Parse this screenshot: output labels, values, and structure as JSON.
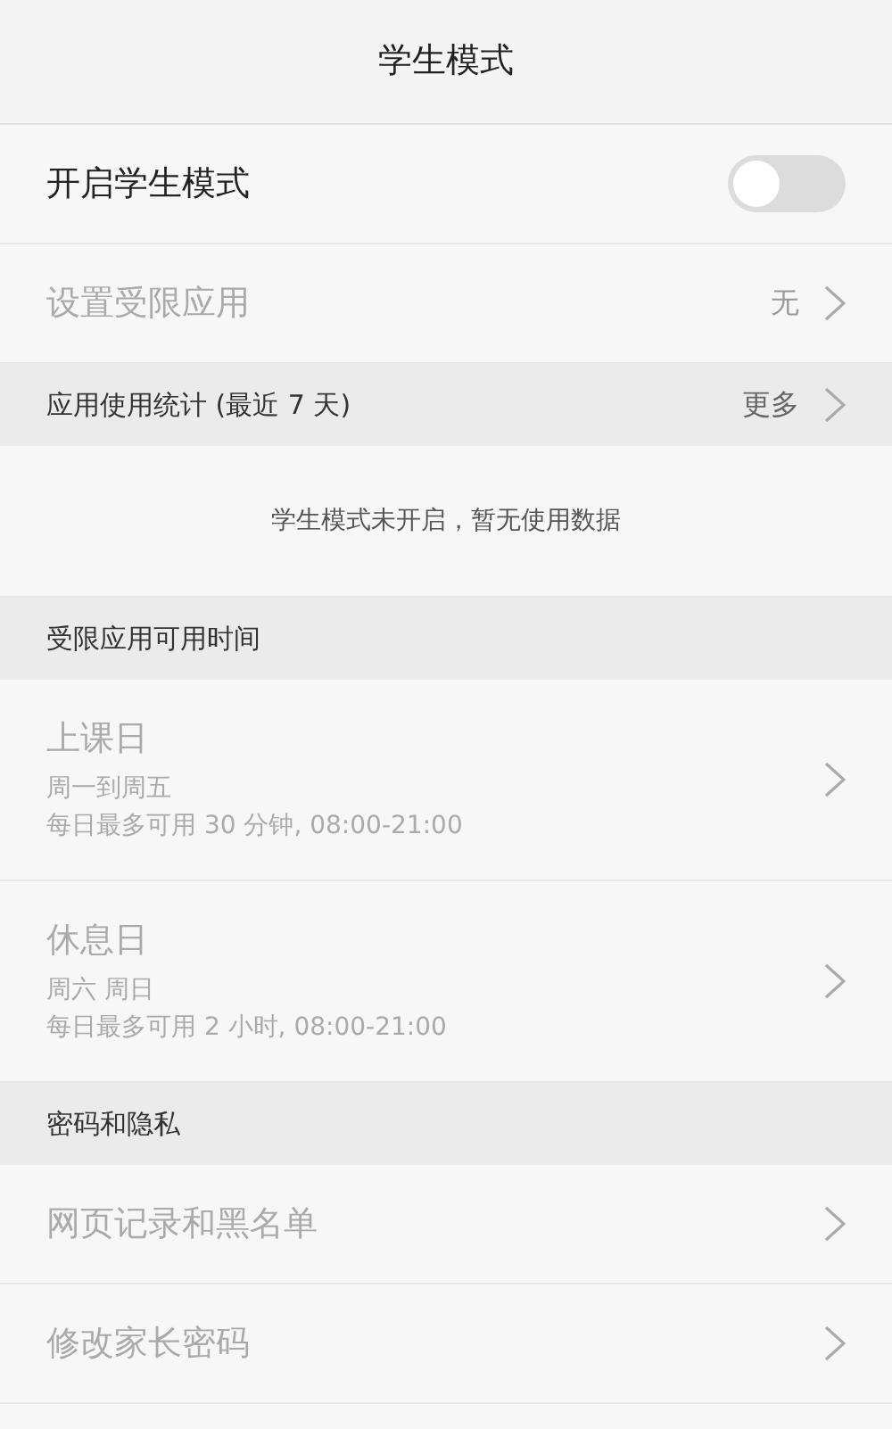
{
  "header": {
    "title": "学生模式"
  },
  "items": [
    {
      "kind": "toggle",
      "label": "开启学生模式",
      "on": false,
      "disabled": false
    },
    {
      "kind": "nav",
      "label": "设置受限应用",
      "value": "无",
      "disabled": true
    },
    {
      "kind": "section",
      "label": "应用使用统计 (最近 7 天)",
      "value": "更多"
    },
    {
      "kind": "note",
      "label": "学生模式未开启，暂无使用数据"
    },
    {
      "kind": "section",
      "label": "受限应用可用时间"
    },
    {
      "kind": "schedule",
      "label": "上课日",
      "days": "周一到周五",
      "limit": "每日最多可用 30 分钟, 08:00-21:00",
      "disabled": true
    },
    {
      "kind": "schedule",
      "label": "休息日",
      "days": "周六 周日",
      "limit": "每日最多可用 2 小时, 08:00-21:00",
      "disabled": true
    },
    {
      "kind": "section",
      "label": "密码和隐私"
    },
    {
      "kind": "nav",
      "label": "网页记录和黑名单",
      "disabled": true
    },
    {
      "kind": "nav",
      "label": "修改家长密码",
      "disabled": true
    }
  ]
}
